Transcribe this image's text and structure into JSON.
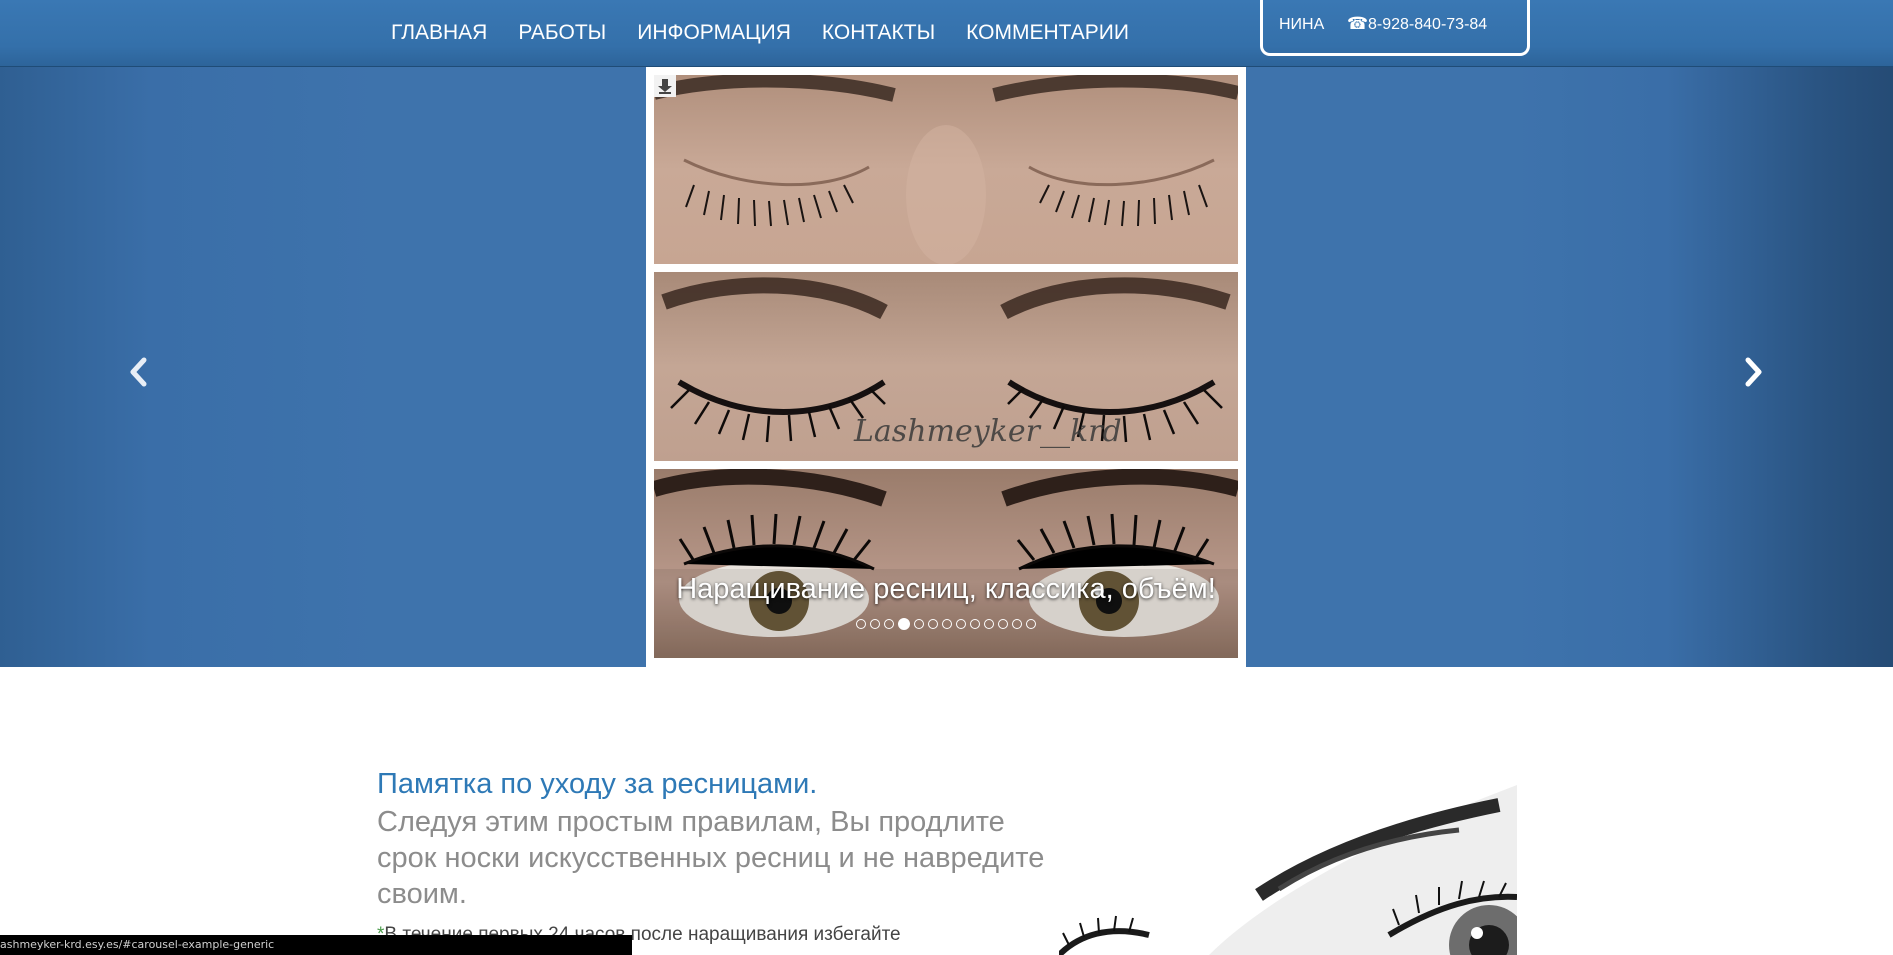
{
  "nav": {
    "items": [
      {
        "label": "ГЛАВНАЯ"
      },
      {
        "label": "РАБОТЫ"
      },
      {
        "label": "ИНФОРМАЦИЯ"
      },
      {
        "label": "КОНТАКТЫ"
      },
      {
        "label": "КОММЕНТАРИИ"
      }
    ]
  },
  "contact": {
    "name": "НИНА",
    "phone_icon": "phone-icon",
    "phone": "8-928-840-73-84"
  },
  "carousel": {
    "watermark": "Lashmeyker__krd",
    "caption": "Наращивание ресниц, классика, объём!",
    "slide_count": 13,
    "active_index": 3,
    "prev_icon": "chevron-left-icon",
    "next_icon": "chevron-right-icon",
    "download_icon": "download-icon"
  },
  "memo": {
    "title": "Памятка по уходу за ресницами.",
    "subtitle": "Следуя этим простым правилам, Вы продлите срок носки искусственных ресниц и не навредите своим.",
    "star": "*",
    "body": "В течение первых 24 часов после наращивания избегайте"
  },
  "status": {
    "url": "ashmeyker-krd.esy.es/#carousel-example-generic"
  },
  "colors": {
    "nav_bg": "#3470aa",
    "hero_bg": "#3e73ac",
    "title_blue": "#2e79b6",
    "subtitle_gray": "#8c8c8c"
  }
}
